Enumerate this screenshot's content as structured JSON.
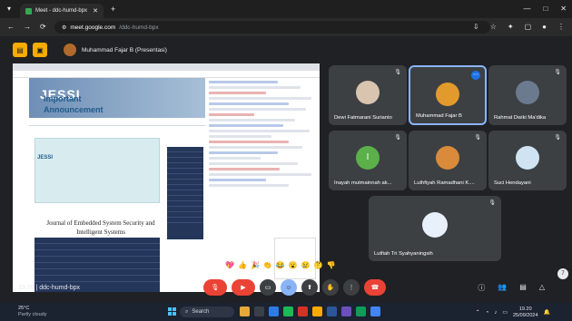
{
  "browser": {
    "tab_title": "Meet - ddc-humd-bpx",
    "new_tab": "+",
    "omnibox_host": "meet.google.com",
    "omnibox_path": "/ddc-humd-bpx",
    "window_controls": [
      "—",
      "□",
      "✕"
    ]
  },
  "meet": {
    "presenter_label": "Muhammad Fajar B (Presentasi)",
    "meeting_code_time": "19.20",
    "meeting_code": "ddc-humd-bpx",
    "shared_screen": {
      "site_title": "JESSI",
      "announcement_line1": "Important",
      "announcement_line2": "Announcement",
      "announcement_logo": "JESSI",
      "journal_title": "Journal of Embedded System Security and Intelligent Systems"
    },
    "participants": [
      {
        "name": "Dewi Fatmarani Surianto",
        "avatar_color": "#d9c4b0"
      },
      {
        "name": "Muhammad Fajar B",
        "avatar_color": "#e39a2d",
        "active": true
      },
      {
        "name": "Rahmat Dwiki Ma'dika",
        "avatar_color": "#6b7a8f"
      },
      {
        "name": "Inayah mutmainnah ak...",
        "avatar_color": "#5bb04a",
        "initial": "I"
      },
      {
        "name": "Luthfiyah Ramadhani K....",
        "avatar_color": "#d98a3a"
      },
      {
        "name": "Suci Hendayani",
        "avatar_color": "#cfe3f2"
      },
      {
        "name": "Lutfiah Tri Syahyaningsih",
        "avatar_color": "#e8f1fb"
      }
    ],
    "reactions": [
      "💖",
      "👍",
      "🎉",
      "👏",
      "😂",
      "😮",
      "😢",
      "🤔",
      "👎"
    ]
  },
  "taskbar": {
    "weather_temp": "25°C",
    "weather_desc": "Partly cloudy",
    "search_label": "Search",
    "time": "19.20",
    "date": "25/09/2024"
  }
}
